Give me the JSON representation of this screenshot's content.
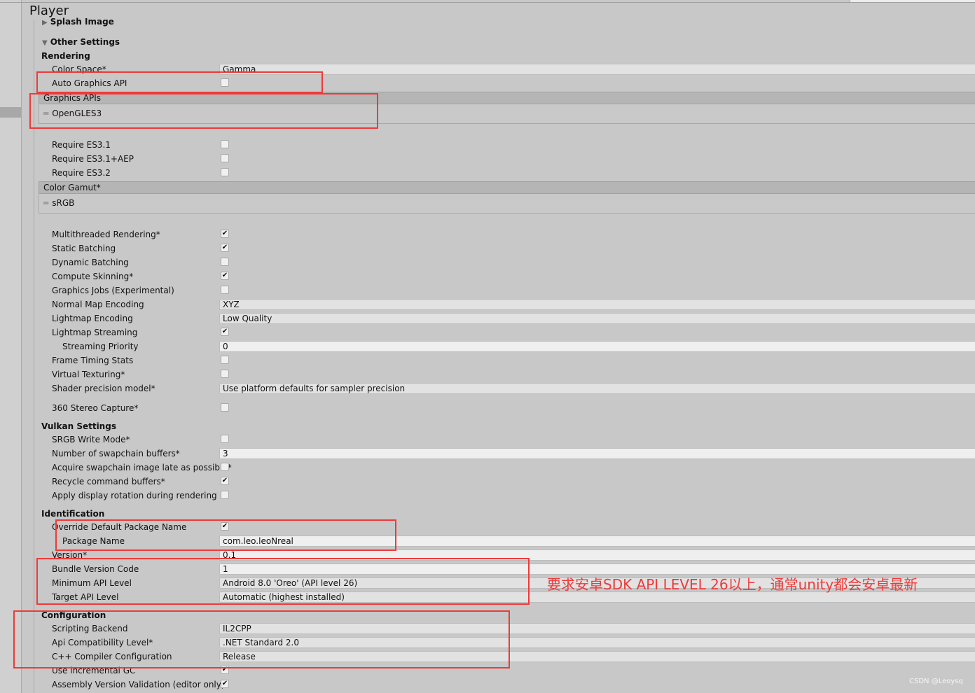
{
  "window": {
    "title": "Player"
  },
  "sections": {
    "splash": {
      "title": "Splash Image"
    },
    "other_settings": {
      "title": "Other Settings"
    },
    "rendering": {
      "title": "Rendering"
    },
    "vulkan": {
      "title": "Vulkan Settings"
    },
    "identification": {
      "title": "Identification"
    },
    "configuration": {
      "title": "Configuration"
    }
  },
  "rendering": {
    "color_space": {
      "label": "Color Space*",
      "value": "Gamma"
    },
    "auto_graphics_api": {
      "label": "Auto Graphics API",
      "checked": false
    },
    "graphics_apis": {
      "label": "Graphics APIs",
      "items": [
        "OpenGLES3"
      ]
    },
    "require_es31": {
      "label": "Require ES3.1",
      "checked": false
    },
    "require_es31_aep": {
      "label": "Require ES3.1+AEP",
      "checked": false
    },
    "require_es32": {
      "label": "Require ES3.2",
      "checked": false
    },
    "color_gamut": {
      "label": "Color Gamut*",
      "items": [
        "sRGB"
      ]
    },
    "multithreaded_rendering": {
      "label": "Multithreaded Rendering*",
      "checked": true
    },
    "static_batching": {
      "label": "Static Batching",
      "checked": true
    },
    "dynamic_batching": {
      "label": "Dynamic Batching",
      "checked": false
    },
    "compute_skinning": {
      "label": "Compute Skinning*",
      "checked": true
    },
    "graphics_jobs": {
      "label": "Graphics Jobs (Experimental)",
      "checked": false
    },
    "normal_map_encoding": {
      "label": "Normal Map Encoding",
      "value": "XYZ"
    },
    "lightmap_encoding": {
      "label": "Lightmap Encoding",
      "value": "Low Quality"
    },
    "lightmap_streaming": {
      "label": "Lightmap Streaming",
      "checked": true
    },
    "streaming_priority": {
      "label": "Streaming Priority",
      "value": "0"
    },
    "frame_timing_stats": {
      "label": "Frame Timing Stats",
      "checked": false
    },
    "virtual_texturing": {
      "label": "Virtual Texturing*",
      "checked": false
    },
    "shader_precision": {
      "label": "Shader precision model*",
      "value": "Use platform defaults for sampler precision"
    },
    "stereo_capture": {
      "label": "360 Stereo Capture*",
      "checked": false
    }
  },
  "vulkan": {
    "srgb_write_mode": {
      "label": "SRGB Write Mode*",
      "checked": false
    },
    "swapchain_buffers": {
      "label": "Number of swapchain buffers*",
      "value": "3"
    },
    "acquire_late": {
      "label": "Acquire swapchain image late as possible*",
      "checked": false
    },
    "recycle_buffers": {
      "label": "Recycle command buffers*",
      "checked": true
    },
    "display_rotation": {
      "label": "Apply display rotation during rendering",
      "checked": false
    }
  },
  "identification": {
    "override_package": {
      "label": "Override Default Package Name",
      "checked": true
    },
    "package_name": {
      "label": "Package Name",
      "value": "com.leo.leoNreal"
    },
    "version": {
      "label": "Version*",
      "value": "0.1"
    },
    "bundle_version_code": {
      "label": "Bundle Version Code",
      "value": "1"
    },
    "min_api_level": {
      "label": "Minimum API Level",
      "value": "Android 8.0 'Oreo' (API level 26)"
    },
    "target_api_level": {
      "label": "Target API Level",
      "value": "Automatic (highest installed)"
    }
  },
  "configuration": {
    "scripting_backend": {
      "label": "Scripting Backend",
      "value": "IL2CPP"
    },
    "api_compat": {
      "label": "Api Compatibility Level*",
      "value": ".NET Standard 2.0"
    },
    "cpp_compiler": {
      "label": "C++ Compiler Configuration",
      "value": "Release"
    },
    "incremental_gc": {
      "label": "Use incremental GC",
      "checked": true
    },
    "assembly_validation": {
      "label": "Assembly Version Validation (editor only)",
      "checked": true
    }
  },
  "annotation": {
    "text": "要求安卓SDK API LEVEL 26以上，通常unity都会安卓最新"
  },
  "watermark": {
    "text": "CSDN @Leoysq"
  },
  "colors": {
    "annotation_red": "#ee3a3a",
    "panel_bg": "#c8c8c8"
  },
  "icons": {
    "foldout": "triangle-icon",
    "reorder": "drag-handle-icon",
    "check": "checkmark-icon"
  }
}
